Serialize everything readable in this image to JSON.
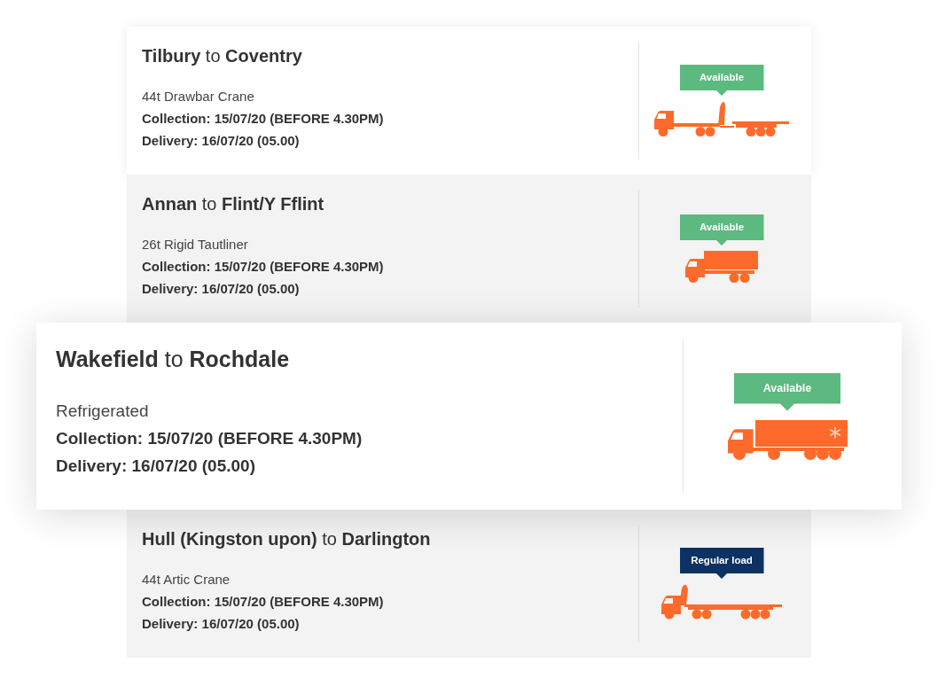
{
  "loads": [
    {
      "route": "**Tilbury** to **Coventry**",
      "vehicle": "44t Drawbar Crane",
      "collection": "Collection: 15/07/20 (BEFORE 4.30PM)",
      "delivery": "Delivery: 16/07/20 (05.00)",
      "badge": {
        "label": "Available",
        "color": "#5cb97f"
      },
      "kind": "drawbar_crane",
      "shaded": false,
      "featured": false
    },
    {
      "route": "**Annan** to **Flint/Y Fflint**",
      "vehicle": "26t Rigid Tautliner",
      "collection": "Collection: 15/07/20 (BEFORE 4.30PM)",
      "delivery": "Delivery: 16/07/20 (05.00)",
      "badge": {
        "label": "Available",
        "color": "#5cb97f"
      },
      "kind": "rigid",
      "shaded": true,
      "featured": false
    },
    {
      "route": "**Wakefield** to **Rochdale**",
      "vehicle": "Refrigerated",
      "collection": "Collection: 15/07/20 (BEFORE 4.30PM)",
      "delivery": "Delivery: 16/07/20 (05.00)",
      "badge": {
        "label": "Available",
        "color": "#5cb97f"
      },
      "kind": "refrigerated",
      "shaded": false,
      "featured": true
    },
    {
      "route": "**Hull (Kingston upon)** to **Darlington**",
      "vehicle": "44t Artic Crane",
      "collection": "Collection: 15/07/20 (BEFORE 4.30PM)",
      "delivery": "Delivery: 16/07/20 (05.00)",
      "badge": {
        "label": "Regular load",
        "color": "#0d3262"
      },
      "kind": "artic_crane",
      "shaded": true,
      "featured": false
    }
  ]
}
